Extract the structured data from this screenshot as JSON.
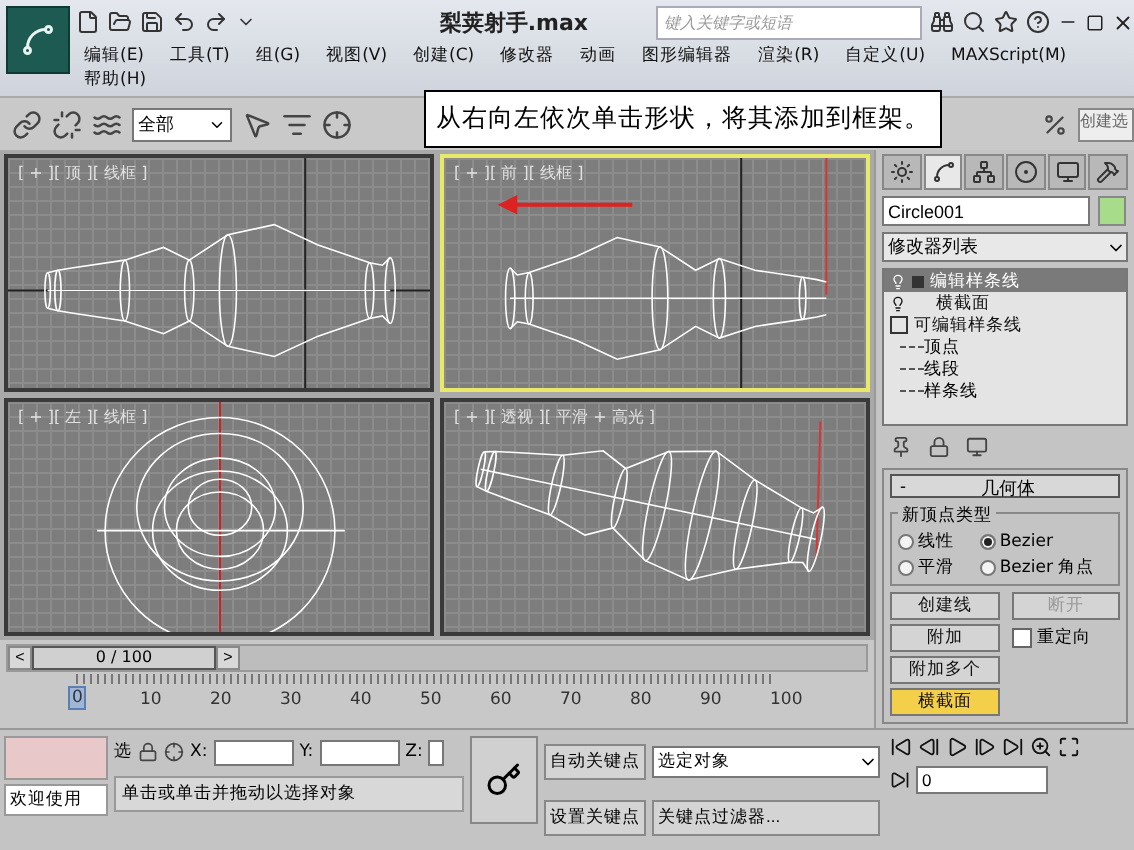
{
  "title_bar": {
    "title": "梨荚射手.max",
    "search": {
      "placeholder": "键入关键字或短语"
    }
  },
  "menu": [
    {
      "label": "编辑(E)"
    },
    {
      "label": "工具(T)"
    },
    {
      "label": "组(G)"
    },
    {
      "label": "视图(V)"
    },
    {
      "label": "创建(C)"
    },
    {
      "label": "修改器"
    },
    {
      "label": "动画"
    },
    {
      "label": "图形编辑器"
    },
    {
      "label": "渲染(R)"
    },
    {
      "label": "自定义(U)"
    },
    {
      "label": "MAXScript(M)"
    },
    {
      "label": "帮助(H)"
    }
  ],
  "toolbar": {
    "filter": "全部",
    "named_selection": "创建选"
  },
  "hint": "从右向左依次单击形状，将其添加到框架。",
  "viewports": [
    {
      "label": "[ + ][ 顶 ][ 线框 ]",
      "kind": "top",
      "selected": false
    },
    {
      "label": "[ + ][ 前 ][ 线框 ]",
      "kind": "front",
      "selected": true
    },
    {
      "label": "[ + ][ 左 ][ 线框 ]",
      "kind": "left",
      "selected": false
    },
    {
      "label": "[ + ][ 透视 ][ 平滑 + 高光 ]",
      "kind": "perspective",
      "selected": false
    }
  ],
  "command_panel": {
    "tabs": [
      {
        "kind": "create",
        "selected": false
      },
      {
        "kind": "modify",
        "selected": true
      },
      {
        "kind": "hierarchy",
        "selected": false
      },
      {
        "kind": "motion",
        "selected": false
      },
      {
        "kind": "display",
        "selected": false
      },
      {
        "kind": "utilities",
        "selected": false
      }
    ],
    "object_name": "Circle001",
    "modifier_list": "修改器列表",
    "stack": [
      {
        "label": "编辑样条线",
        "kind": "modifier",
        "expandable": true,
        "selected": true
      },
      {
        "label": "横截面",
        "kind": "modifier",
        "expandable": false,
        "selected": false
      },
      {
        "label": "可编辑样条线",
        "kind": "base",
        "expandable": true,
        "selected": false,
        "children": [
          {
            "label": "顶点",
            "selected": false
          },
          {
            "label": "线段",
            "selected": false
          },
          {
            "label": "样条线",
            "selected": false
          }
        ]
      }
    ],
    "geometry": {
      "collapse": "-",
      "title": "几何体",
      "group": "新顶点类型",
      "vertex_types": [
        {
          "label": "线性",
          "selected": false
        },
        {
          "label": "Bezier",
          "selected": true
        },
        {
          "label": "平滑",
          "selected": false
        },
        {
          "label": "Bezier 角点",
          "selected": false
        }
      ],
      "buttons": [
        {
          "label": "创建线",
          "disabled": false,
          "active": false
        },
        {
          "label": "断开",
          "disabled": true,
          "active": false
        },
        {
          "label": "附加",
          "disabled": false,
          "active": false
        },
        {
          "label": "附加多个",
          "disabled": false,
          "active": false
        },
        {
          "label": "横截面",
          "disabled": false,
          "active": true
        }
      ],
      "reorient": {
        "label": "重定向",
        "checked": false
      }
    }
  },
  "timeline": {
    "prev": "<",
    "position": "0 / 100",
    "next": ">",
    "ticks": [
      {
        "label": "0",
        "selected": true
      },
      {
        "label": "10",
        "selected": false
      },
      {
        "label": "20",
        "selected": false
      },
      {
        "label": "30",
        "selected": false
      },
      {
        "label": "40",
        "selected": false
      },
      {
        "label": "50",
        "selected": false
      },
      {
        "label": "60",
        "selected": false
      },
      {
        "label": "70",
        "selected": false
      },
      {
        "label": "80",
        "selected": false
      },
      {
        "label": "90",
        "selected": false
      },
      {
        "label": "100",
        "selected": false
      }
    ]
  },
  "status": {
    "welcome": "欢迎使用",
    "select": "选",
    "x_label": "X:",
    "y_label": "Y:",
    "z_label": "Z:",
    "prompt": "单击或单击并拖动以选择对象",
    "auto_key": "自动关键点",
    "set_key": "设置关键点",
    "key_mode": "选定对象",
    "key_filters": "关键点过滤器...",
    "frame": "0"
  }
}
